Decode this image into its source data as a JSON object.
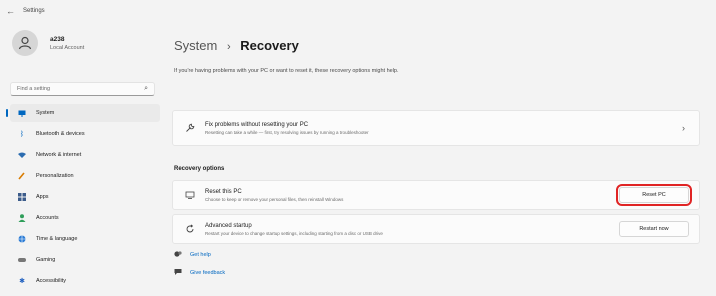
{
  "window": {
    "title": "Settings",
    "back_icon": "back-arrow-icon"
  },
  "profile": {
    "name": "a238",
    "account_type": "Local Account",
    "avatar_icon": "user-icon"
  },
  "search": {
    "placeholder": "Find a setting",
    "icon": "search-icon"
  },
  "sidebar": {
    "items": [
      {
        "label": "System",
        "icon": "monitor-icon",
        "active": true
      },
      {
        "label": "Bluetooth & devices",
        "icon": "bluetooth-icon"
      },
      {
        "label": "Network & internet",
        "icon": "wifi-icon"
      },
      {
        "label": "Personalization",
        "icon": "brush-icon"
      },
      {
        "label": "Apps",
        "icon": "apps-icon"
      },
      {
        "label": "Accounts",
        "icon": "person-icon"
      },
      {
        "label": "Time & language",
        "icon": "globe-icon"
      },
      {
        "label": "Gaming",
        "icon": "controller-icon"
      },
      {
        "label": "Accessibility",
        "icon": "accessibility-icon"
      }
    ]
  },
  "main": {
    "breadcrumb": {
      "parent": "System",
      "separator": "›",
      "current": "Recovery"
    },
    "description": "If you're having problems with your PC or want to reset it, these recovery options might help.",
    "fix_card": {
      "title": "Fix problems without resetting your PC",
      "subtitle": "Resetting can take a while — first, try resolving issues by running a troubleshooter",
      "icon": "wrench-icon",
      "chevron": "›"
    },
    "section_title": "Recovery options",
    "reset_card": {
      "title": "Reset this PC",
      "subtitle": "Choose to keep or remove your personal files, then reinstall Windows",
      "button": "Reset PC",
      "icon": "reset-pc-icon"
    },
    "advanced_card": {
      "title": "Advanced startup",
      "subtitle": "Restart your device to change startup settings, including starting from a disc or USB drive",
      "button": "Restart now",
      "icon": "restart-icon"
    },
    "links": [
      {
        "label": "Get help",
        "icon": "help-icon"
      },
      {
        "label": "Give feedback",
        "icon": "feedback-icon"
      }
    ]
  },
  "colors": {
    "accent": "#0067c0",
    "highlight": "#e02424",
    "background": "#f3f3f3",
    "card": "#fbfbfb"
  }
}
